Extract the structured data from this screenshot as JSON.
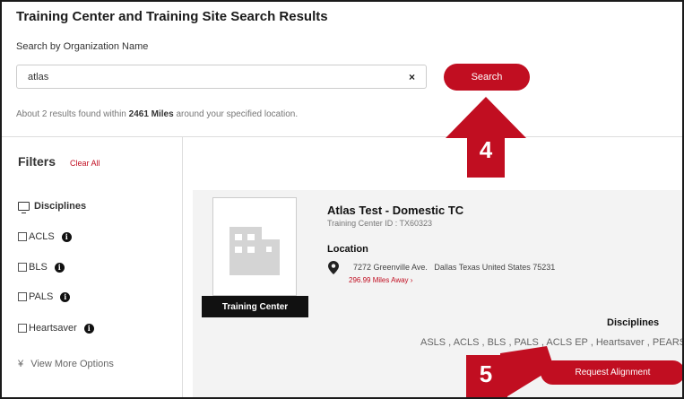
{
  "page": {
    "title": "Training Center and Training Site Search Results"
  },
  "search": {
    "label": "Search by Organization Name",
    "value": "atlas",
    "clear_label": "×",
    "button_label": "Search"
  },
  "results": {
    "prefix": "About 2 results found within",
    "miles": "2461 Miles",
    "suffix": "around your specified location."
  },
  "filters": {
    "title": "Filters",
    "clear_all": "Clear All",
    "group_label": "Disciplines",
    "items": [
      {
        "label": "ACLS"
      },
      {
        "label": "BLS"
      },
      {
        "label": "PALS"
      },
      {
        "label": "Heartsaver"
      }
    ],
    "more_options": "View More Options"
  },
  "result_card": {
    "name": "Atlas Test - Domestic TC",
    "id_line": "Training Center ID : TX60323",
    "badge": "Training Center",
    "location_label": "Location",
    "address": "7272 Greenville Ave.   Dallas Texas United States 75231",
    "distance": "296.99 Miles Away ›",
    "disciplines_label": "Disciplines",
    "disciplines": "ASLS , ACLS , BLS , PALS , ACLS EP , Heartsaver , PEARS",
    "request_button": "Request Alignment"
  },
  "callouts": {
    "step4": "4",
    "step5": "5",
    "color": "#c10e21"
  }
}
